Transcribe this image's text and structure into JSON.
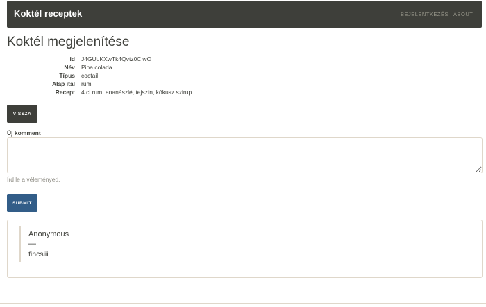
{
  "navbar": {
    "brand": "Koktél receptek",
    "links": {
      "login": "BEJELENTKEZÉS",
      "about": "ABOUT"
    },
    "colors": {
      "background": "#3e3f3a",
      "link": "#98978b"
    }
  },
  "page": {
    "title": "Koktél megjelenítése"
  },
  "details": [
    {
      "key": "id",
      "value": "J4GUuKXwTk4Qvtz0CiwO"
    },
    {
      "key": "Név",
      "value": "Pina colada"
    },
    {
      "key": "Típus",
      "value": "coctail"
    },
    {
      "key": "Alap ital",
      "value": "rum"
    },
    {
      "key": "Recept",
      "value": "4 cl rum, ananászlé, tejszín, kókusz szirup"
    }
  ],
  "buttons": {
    "back": "VISSZA",
    "submit": "SUBMIT"
  },
  "comment_form": {
    "label": "Új komment",
    "value": "",
    "help": "Írd le a véleményed."
  },
  "comments": [
    {
      "author": "Anonymous",
      "separator": "—",
      "text": "fincsiii"
    }
  ],
  "colors": {
    "primary": "#325d88",
    "dark": "#3e3f3a",
    "border": "#dfd7ca",
    "muted": "#8e8c84"
  }
}
